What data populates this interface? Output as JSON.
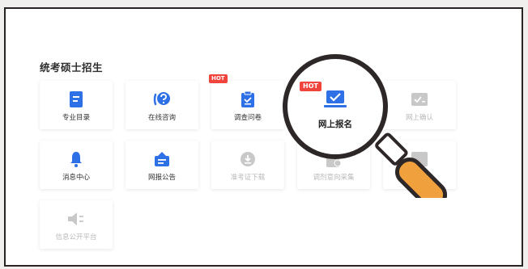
{
  "section": {
    "title": "统考硕士招生"
  },
  "colors": {
    "accent": "#2e70e6",
    "hot": "#f0443d",
    "handle": "#f0a03c",
    "disabled": "#c8c8c8"
  },
  "cards": {
    "c1": {
      "label": "专业目录",
      "icon": "document-list-icon"
    },
    "c2": {
      "label": "在线咨询",
      "icon": "chat-question-icon"
    },
    "c3": {
      "label": "调查问卷",
      "icon": "clipboard-check-icon",
      "badge": "HOT"
    },
    "c4": {
      "label": "网上报名",
      "icon": "laptop-check-icon",
      "badge": "HOT"
    },
    "c5": {
      "label": "网上确认",
      "icon": "id-check-icon"
    },
    "c6": {
      "label": "消息中心",
      "icon": "bell-icon"
    },
    "c7": {
      "label": "网报公告",
      "icon": "announcement-icon"
    },
    "c8": {
      "label": "准考证下载",
      "icon": "download-icon"
    },
    "c9": {
      "label": "调剂意向采集",
      "icon": "survey-icon"
    },
    "c10": {
      "label": "网上调剂",
      "icon": "transfer-icon"
    },
    "c11": {
      "label": "信息公开平台",
      "icon": "speaker-icon"
    }
  }
}
